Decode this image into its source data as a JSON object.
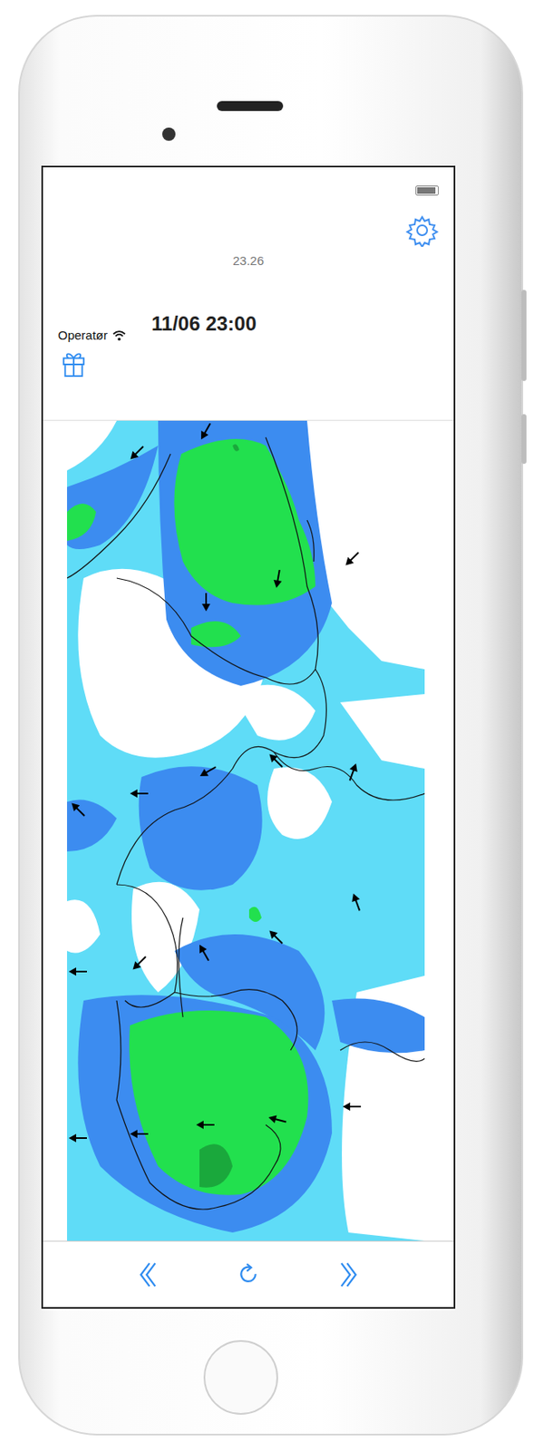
{
  "status_bar": {
    "time": "23.26",
    "carrier": "Operatør",
    "wifi": true,
    "battery": {
      "level": 0.9
    }
  },
  "header": {
    "title": "11/06 23:00"
  }
}
